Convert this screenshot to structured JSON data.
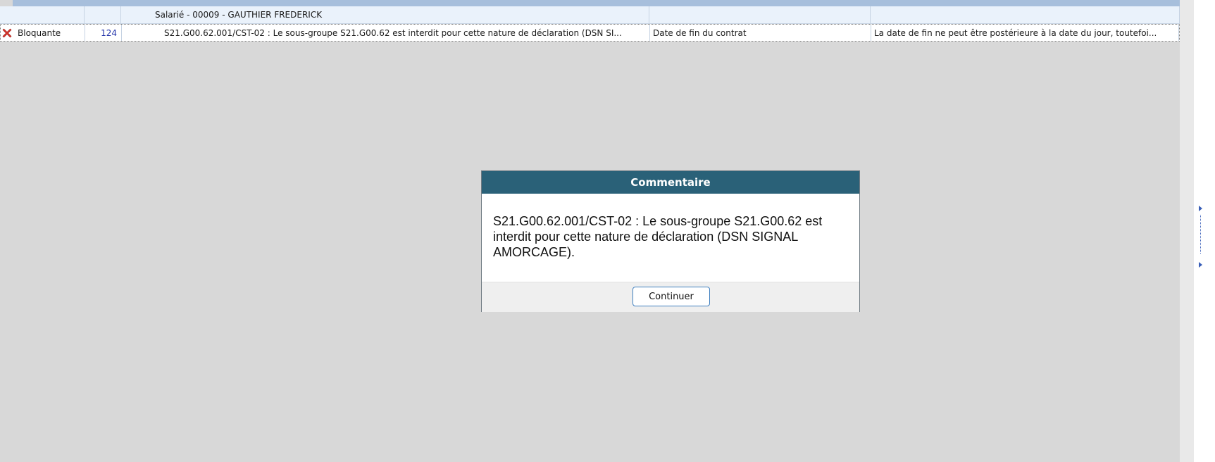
{
  "grid": {
    "group_row": {
      "label": "Salarié - 00009 - GAUTHIER FREDERICK"
    },
    "error_row": {
      "icon": "error-x-icon",
      "severity": "Bloquante",
      "number": "124",
      "message": "S21.G00.62.001/CST-02 : Le sous-groupe S21.G00.62 est interdit pour cette nature de déclaration (DSN SI...",
      "field": "Date de fin du contrat",
      "description": "La date de fin ne peut être postérieure à la date du jour, toutefoi..."
    }
  },
  "modal": {
    "title": "Commentaire",
    "message": "S21.G00.62.001/CST-02 : Le sous-groupe S21.G00.62 est interdit pour cette nature de déclaration (DSN SIGNAL AMORCAGE).",
    "continue_label": "Continuer"
  },
  "colors": {
    "modal_header": "#2a6178",
    "background": "#d8d8d8",
    "grid_header": "#a7bfdc",
    "group_row": "#eaf2fb",
    "error_icon": "#d9342b",
    "button_border": "#3f7fbf"
  }
}
